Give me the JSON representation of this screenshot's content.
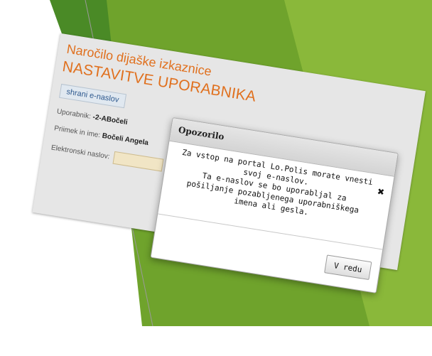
{
  "colors": {
    "accent_orange": "#e0701e",
    "bg_green_light": "#8ab83a",
    "bg_green_mid": "#6fa32c",
    "bg_green_dark": "#4a8a26",
    "input_fill": "#f1e5c5"
  },
  "app": {
    "title": "Naročilo dijaške izkaznice",
    "subtitle": "NASTAVITVE UPORABNIKA",
    "save_button": "shrani e-naslov",
    "fields": {
      "user_label": "Uporabnik:",
      "user_value": "-2-ABočeli",
      "name_label": "Priimek in ime:",
      "name_value": "Bočeli Angela",
      "email_label": "Elektronski naslov:"
    }
  },
  "dialog": {
    "title": "Opozorilo",
    "close_icon": "close-icon",
    "line1": "Za vstop na portal Lo.Polis morate vnesti",
    "line2": "svoj e-naslov.",
    "line3": "Ta e-naslov se bo uporabljal za",
    "line4": "pošiljanje pozabljenega uporabniškega",
    "line5": "imena ali gesla.",
    "ok_button": "V redu"
  }
}
